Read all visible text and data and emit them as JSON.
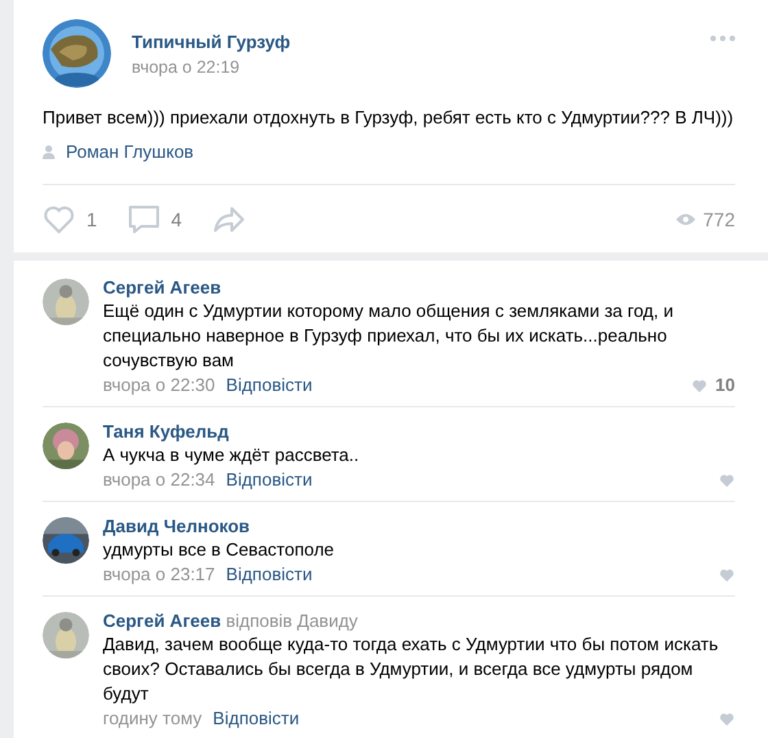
{
  "post": {
    "author": "Типичный Гурзуф",
    "time": "вчора о 22:19",
    "text": "Привет всем))) приехали отдохнуть в Гурзуф, ребят есть кто с Удмуртии??? В ЛЧ)))",
    "signer": "Роман Глушков",
    "likes": "1",
    "comments": "4",
    "views": "772"
  },
  "comments": [
    {
      "author": "Сергей Агеев",
      "text": "Ещё один с Удмуртии которому мало общения с земляками за год, и специально наверное в Гурзуф приехал, что бы их искать...реально сочувствую вам",
      "time": "вчора о 22:30",
      "reply": "Відповісти",
      "likes": "10"
    },
    {
      "author": "Таня Куфельд",
      "text": "А чукча в чуме ждёт рассвета..",
      "time": "вчора о 22:34",
      "reply": "Відповісти"
    },
    {
      "author": "Давид Челноков",
      "text": "удмурты все в Севастополе",
      "time": "вчора о 23:17",
      "reply": "Відповісти"
    },
    {
      "author": "Сергей Агеев",
      "reply_to": "відповів Давиду",
      "text": "Давид, зачем вообще куда-то тогда ехать с Удмуртии что бы потом искать своих? Оставались бы всегда в Удмуртии, и всегда все удмурты рядом будут",
      "time": "годину тому",
      "reply": "Відповісти"
    }
  ]
}
